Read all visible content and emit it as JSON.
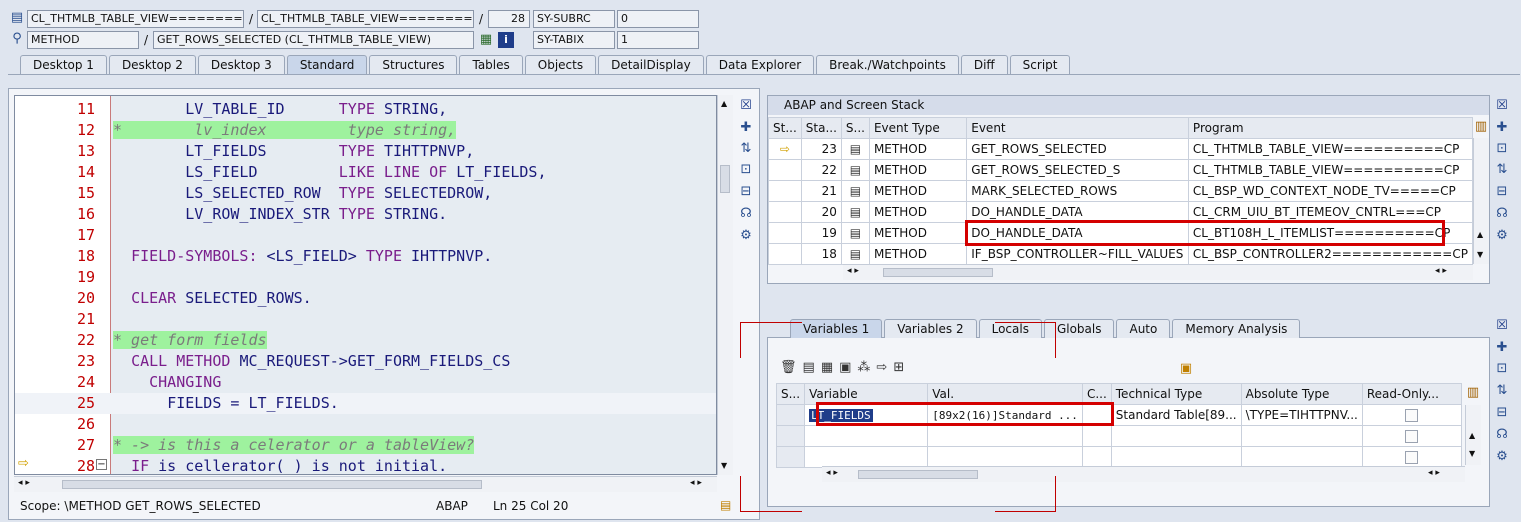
{
  "top": {
    "row1": {
      "class1": "CL_THTMLB_TABLE_VIEW=========...",
      "slash": "/",
      "class2": "CL_THTMLB_TABLE_VIEW=========...",
      "slash2": "/",
      "line": "28",
      "sysvar": "SY-SUBRC",
      "sysval": "0"
    },
    "row2": {
      "kind": "METHOD",
      "slash": "/",
      "method": "GET_ROWS_SELECTED (CL_THTMLB_TABLE_VIEW)",
      "sysvar": "SY-TABIX",
      "sysval": "1"
    }
  },
  "tabs": [
    {
      "label": "Desktop 1",
      "active": false
    },
    {
      "label": "Desktop 2",
      "active": false
    },
    {
      "label": "Desktop 3",
      "active": false
    },
    {
      "label": "Standard",
      "active": true
    },
    {
      "label": "Structures",
      "active": false
    },
    {
      "label": "Tables",
      "active": false
    },
    {
      "label": "Objects",
      "active": false
    },
    {
      "label": "DetailDisplay",
      "active": false
    },
    {
      "label": "Data Explorer",
      "active": false
    },
    {
      "label": "Break./Watchpoints",
      "active": false
    },
    {
      "label": "Diff",
      "active": false
    },
    {
      "label": "Script",
      "active": false
    }
  ],
  "editor": {
    "lines": [
      {
        "num": "11",
        "parts": [
          {
            "t": "        ",
            "c": ""
          },
          {
            "t": "LV_TABLE_ID",
            "c": "id"
          },
          {
            "t": "      ",
            "c": ""
          },
          {
            "t": "TYPE",
            "c": "kw"
          },
          {
            "t": " ",
            "c": ""
          },
          {
            "t": "STRING,",
            "c": "id"
          }
        ]
      },
      {
        "num": "12",
        "parts": [
          {
            "t": "*        lv_index         type string,",
            "c": "cm"
          }
        ]
      },
      {
        "num": "13",
        "parts": [
          {
            "t": "        ",
            "c": ""
          },
          {
            "t": "LT_FIELDS",
            "c": "id"
          },
          {
            "t": "        ",
            "c": ""
          },
          {
            "t": "TYPE",
            "c": "kw"
          },
          {
            "t": " ",
            "c": ""
          },
          {
            "t": "TIHTTPNVP,",
            "c": "id"
          }
        ]
      },
      {
        "num": "14",
        "parts": [
          {
            "t": "        ",
            "c": ""
          },
          {
            "t": "LS_FIELD",
            "c": "id"
          },
          {
            "t": "         ",
            "c": ""
          },
          {
            "t": "LIKE LINE OF",
            "c": "kw"
          },
          {
            "t": " ",
            "c": ""
          },
          {
            "t": "LT_FIELDS,",
            "c": "id"
          }
        ]
      },
      {
        "num": "15",
        "parts": [
          {
            "t": "        ",
            "c": ""
          },
          {
            "t": "LS_SELECTED_ROW",
            "c": "id"
          },
          {
            "t": "  ",
            "c": ""
          },
          {
            "t": "TYPE",
            "c": "kw"
          },
          {
            "t": " ",
            "c": ""
          },
          {
            "t": "SELECTEDROW,",
            "c": "id"
          }
        ]
      },
      {
        "num": "16",
        "parts": [
          {
            "t": "        ",
            "c": ""
          },
          {
            "t": "LV_ROW_INDEX_STR",
            "c": "id"
          },
          {
            "t": " ",
            "c": ""
          },
          {
            "t": "TYPE",
            "c": "kw"
          },
          {
            "t": " ",
            "c": ""
          },
          {
            "t": "STRING.",
            "c": "id"
          }
        ]
      },
      {
        "num": "17",
        "parts": []
      },
      {
        "num": "18",
        "parts": [
          {
            "t": "  ",
            "c": ""
          },
          {
            "t": "FIELD-SYMBOLS:",
            "c": "kw"
          },
          {
            "t": " ",
            "c": ""
          },
          {
            "t": "<LS_FIELD>",
            "c": "id"
          },
          {
            "t": " ",
            "c": ""
          },
          {
            "t": "TYPE",
            "c": "kw"
          },
          {
            "t": " ",
            "c": ""
          },
          {
            "t": "IHTTPNVP.",
            "c": "id"
          }
        ]
      },
      {
        "num": "19",
        "parts": []
      },
      {
        "num": "20",
        "parts": [
          {
            "t": "  ",
            "c": ""
          },
          {
            "t": "CLEAR",
            "c": "kw"
          },
          {
            "t": " ",
            "c": ""
          },
          {
            "t": "SELECTED_ROWS.",
            "c": "id"
          }
        ]
      },
      {
        "num": "21",
        "parts": []
      },
      {
        "num": "22",
        "parts": [
          {
            "t": "* get form fields",
            "c": "cm"
          }
        ]
      },
      {
        "num": "23",
        "parts": [
          {
            "t": "  ",
            "c": ""
          },
          {
            "t": "CALL METHOD",
            "c": "kw"
          },
          {
            "t": " ",
            "c": ""
          },
          {
            "t": "MC_REQUEST->GET_FORM_FIELDS_CS",
            "c": "id"
          }
        ]
      },
      {
        "num": "24",
        "parts": [
          {
            "t": "    ",
            "c": ""
          },
          {
            "t": "CHANGING",
            "c": "kw"
          }
        ]
      },
      {
        "num": "25",
        "parts": [
          {
            "t": "      ",
            "c": ""
          },
          {
            "t": "FIELDS = LT_FIELDS.",
            "c": "id"
          }
        ]
      },
      {
        "num": "26",
        "parts": []
      },
      {
        "num": "27",
        "parts": [
          {
            "t": "* -> is this a celerator or a tableView?",
            "c": "cm"
          }
        ]
      },
      {
        "num": "28",
        "parts": [
          {
            "t": "  ",
            "c": ""
          },
          {
            "t": "IF",
            "c": "kw"
          },
          {
            "t": " ",
            "c": ""
          },
          {
            "t": "is_cellerator( ) is not initial.",
            "c": "id"
          }
        ]
      }
    ],
    "status": {
      "scope": "Scope: \\METHOD GET_ROWS_SELECTED",
      "lang": "ABAP",
      "pos": "Ln  25 Col  20"
    }
  },
  "stack": {
    "title": "ABAP and Screen Stack",
    "columns": [
      "St...",
      "Sta...",
      "S...",
      "Event Type",
      "Event",
      "Program"
    ],
    "rows": [
      {
        "current": true,
        "level": "23",
        "type": "METHOD",
        "event": "GET_ROWS_SELECTED",
        "program": "CL_THTMLB_TABLE_VIEW==========CP"
      },
      {
        "current": false,
        "level": "22",
        "type": "METHOD",
        "event": "GET_ROWS_SELECTED_S",
        "program": "CL_THTMLB_TABLE_VIEW==========CP"
      },
      {
        "current": false,
        "level": "21",
        "type": "METHOD",
        "event": "MARK_SELECTED_ROWS",
        "program": "CL_BSP_WD_CONTEXT_NODE_TV=====CP"
      },
      {
        "current": false,
        "level": "20",
        "type": "METHOD",
        "event": "DO_HANDLE_DATA",
        "program": "CL_CRM_UIU_BT_ITEMEOV_CNTRL===CP"
      },
      {
        "current": false,
        "level": "19",
        "type": "METHOD",
        "event": "DO_HANDLE_DATA",
        "program": "CL_BT108H_L_ITEMLIST==========CP"
      },
      {
        "current": false,
        "level": "18",
        "type": "METHOD",
        "event": "IF_BSP_CONTROLLER~FILL_VALUES",
        "program": "CL_BSP_CONTROLLER2============CP"
      }
    ]
  },
  "vartabs": [
    {
      "label": "Variables 1",
      "active": true
    },
    {
      "label": "Variables 2",
      "active": false
    },
    {
      "label": "Locals",
      "active": false
    },
    {
      "label": "Globals",
      "active": false
    },
    {
      "label": "Auto",
      "active": false
    },
    {
      "label": "Memory Analysis",
      "active": false
    }
  ],
  "vars": {
    "columns": [
      "S...",
      "Variable",
      "Val.",
      "C...",
      "Technical Type",
      "Absolute Type",
      "Read-Only..."
    ],
    "rows": [
      {
        "variable": "LT_FIELDS",
        "value": "[89x2(16)]Standard ...",
        "tech": "Standard Table[89...",
        "abs": "\\TYPE=TIHTTPNV..."
      }
    ]
  }
}
